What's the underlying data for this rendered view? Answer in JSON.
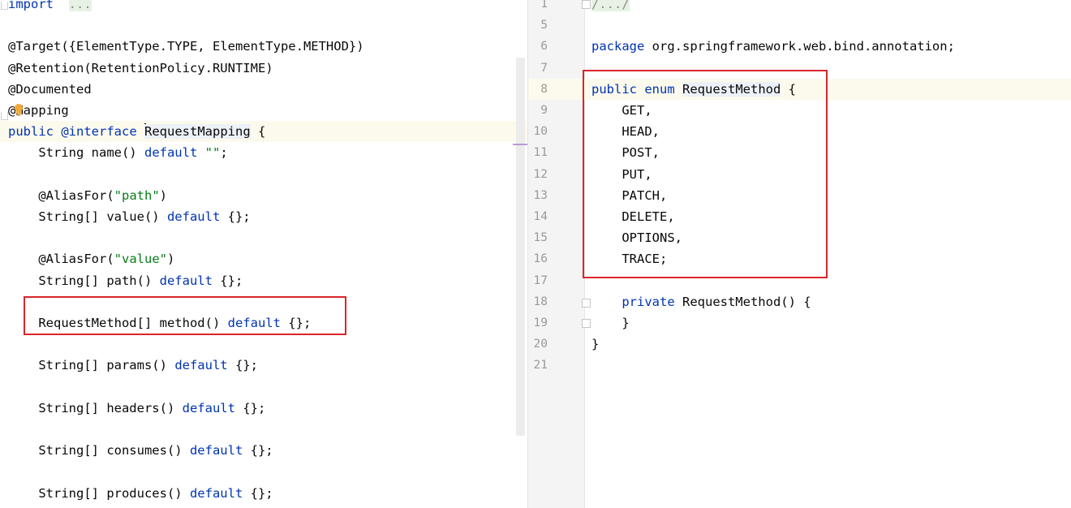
{
  "left_editor": {
    "lines": [
      {
        "parts": [
          [
            "kw",
            "import"
          ],
          [
            "",
            "  "
          ],
          [
            "fold",
            "..."
          ]
        ]
      },
      {
        "parts": []
      },
      {
        "parts": [
          [
            "ann",
            "@Target({ElementType.TYPE, ElementType.METHOD})"
          ]
        ]
      },
      {
        "parts": [
          [
            "ann",
            "@Retention(RetentionPolicy.RUNTIME)"
          ]
        ]
      },
      {
        "parts": [
          [
            "ann",
            "@Documented"
          ]
        ]
      },
      {
        "parts": [
          [
            "ann",
            "@"
          ],
          [
            "bulb",
            ""
          ],
          [
            "ann",
            "Mapping"
          ]
        ]
      },
      {
        "parts": [
          [
            "kw",
            "public"
          ],
          [
            "",
            " "
          ],
          [
            "kw",
            "@interface"
          ],
          [
            "",
            " "
          ],
          [
            "caret",
            ""
          ],
          [
            "type",
            "RequestMapping"
          ],
          [
            "",
            " {"
          ]
        ],
        "current": true
      },
      {
        "parts": [
          [
            "",
            "    String name() "
          ],
          [
            "kw",
            "default"
          ],
          [
            "",
            " "
          ],
          [
            "str",
            "\"\""
          ],
          [
            "",
            ";"
          ]
        ]
      },
      {
        "parts": []
      },
      {
        "parts": [
          [
            "",
            "    @AliasFor("
          ],
          [
            "str",
            "\"path\""
          ],
          [
            "",
            ")"
          ]
        ]
      },
      {
        "parts": [
          [
            "",
            "    String[] value() "
          ],
          [
            "kw",
            "default"
          ],
          [
            "",
            " {};"
          ]
        ]
      },
      {
        "parts": []
      },
      {
        "parts": [
          [
            "",
            "    @AliasFor("
          ],
          [
            "str",
            "\"value\""
          ],
          [
            "",
            ")"
          ]
        ]
      },
      {
        "parts": [
          [
            "",
            "    String[] path() "
          ],
          [
            "kw",
            "default"
          ],
          [
            "",
            " {};"
          ]
        ]
      },
      {
        "parts": []
      },
      {
        "parts": [
          [
            "",
            "    RequestMethod[] method() "
          ],
          [
            "kw",
            "default"
          ],
          [
            "",
            " {};"
          ]
        ]
      },
      {
        "parts": []
      },
      {
        "parts": [
          [
            "",
            "    String[] params() "
          ],
          [
            "kw",
            "default"
          ],
          [
            "",
            " {};"
          ]
        ]
      },
      {
        "parts": []
      },
      {
        "parts": [
          [
            "",
            "    String[] headers() "
          ],
          [
            "kw",
            "default"
          ],
          [
            "",
            " {};"
          ]
        ]
      },
      {
        "parts": []
      },
      {
        "parts": [
          [
            "",
            "    String[] consumes() "
          ],
          [
            "kw",
            "default"
          ],
          [
            "",
            " {};"
          ]
        ]
      },
      {
        "parts": []
      },
      {
        "parts": [
          [
            "",
            "    String[] produces() "
          ],
          [
            "kw",
            "default"
          ],
          [
            "",
            " {};"
          ]
        ]
      },
      {
        "parts": [
          [
            "",
            "}"
          ]
        ]
      }
    ]
  },
  "right_editor": {
    "lines": [
      {
        "num": "1",
        "parts": [
          [
            "fold",
            "/.../"
          ]
        ]
      },
      {
        "num": "5",
        "parts": []
      },
      {
        "num": "6",
        "parts": [
          [
            "kw",
            "package"
          ],
          [
            "",
            " org.springframework.web.bind.annotation;"
          ]
        ]
      },
      {
        "num": "7",
        "parts": []
      },
      {
        "num": "8",
        "parts": [
          [
            "kw",
            "public"
          ],
          [
            "",
            " "
          ],
          [
            "kw",
            "enum"
          ],
          [
            "",
            " "
          ],
          [
            "type",
            "RequestMethod"
          ],
          [
            "",
            " {"
          ]
        ],
        "current": true
      },
      {
        "num": "9",
        "parts": [
          [
            "",
            "    GET,"
          ]
        ]
      },
      {
        "num": "10",
        "parts": [
          [
            "",
            "    HEAD,"
          ]
        ]
      },
      {
        "num": "11",
        "parts": [
          [
            "",
            "    POST,"
          ]
        ]
      },
      {
        "num": "12",
        "parts": [
          [
            "",
            "    PUT,"
          ]
        ]
      },
      {
        "num": "13",
        "parts": [
          [
            "",
            "    PATCH,"
          ]
        ]
      },
      {
        "num": "14",
        "parts": [
          [
            "",
            "    DELETE,"
          ]
        ]
      },
      {
        "num": "15",
        "parts": [
          [
            "",
            "    OPTIONS,"
          ]
        ]
      },
      {
        "num": "16",
        "parts": [
          [
            "",
            "    TRACE;"
          ]
        ]
      },
      {
        "num": "17",
        "parts": []
      },
      {
        "num": "18",
        "parts": [
          [
            "",
            "    "
          ],
          [
            "kw",
            "private"
          ],
          [
            "",
            " RequestMethod() {"
          ]
        ]
      },
      {
        "num": "19",
        "parts": [
          [
            "",
            "    }"
          ]
        ]
      },
      {
        "num": "20",
        "parts": [
          [
            "",
            "}"
          ]
        ]
      },
      {
        "num": "21",
        "parts": []
      }
    ]
  },
  "colors": {
    "keyword": "#0033b3",
    "string": "#067d17",
    "highlight_box": "#d8262c",
    "current_line": "#fcfaed"
  }
}
